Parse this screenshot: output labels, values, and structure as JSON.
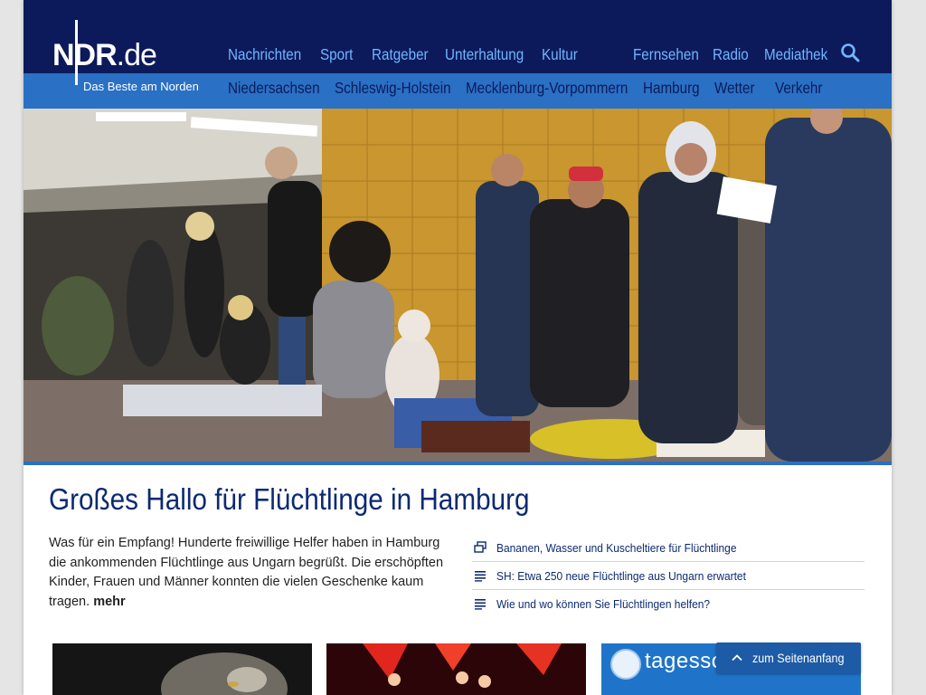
{
  "site": {
    "logo_main": "NDR",
    "logo_suffix": ".de",
    "tagline": "Das Beste am Norden"
  },
  "nav_main": [
    "Nachrichten",
    "Sport",
    "Ratgeber",
    "Unterhaltung",
    "Kultur",
    "Fernsehen",
    "Radio",
    "Mediathek"
  ],
  "nav_sub": [
    "Niedersachsen",
    "Schleswig-Holstein",
    "Mecklenburg-Vorpommern",
    "Hamburg",
    "Wetter",
    "Verkehr"
  ],
  "icons": {
    "search": "search-icon",
    "gallery": "gallery-icon",
    "article": "article-icon",
    "up": "chevron-up-icon"
  },
  "colors": {
    "header": "#0c1a5b",
    "nav_band": "#2a70c4",
    "link": "#6fb6ff",
    "headline": "#0c2a72"
  },
  "hero": {
    "headline": "Großes Hallo für Flüchtlinge in Hamburg",
    "teaser": "Was für ein Empfang! Hunderte freiwillige Helfer haben in Hamburg die ankommenden Flüchtlinge aus Ungarn begrüßt. Die erschöpften Kinder, Frauen und Männer konnten die vielen Geschenke kaum tragen.",
    "more": "mehr"
  },
  "related": [
    {
      "icon": "gallery-icon",
      "label": "Bananen, Wasser und Kuscheltiere für Flüchtlinge"
    },
    {
      "icon": "article-icon",
      "label": "SH: Etwa 250 neue Flüchtlinge aus Ungarn erwartet"
    },
    {
      "icon": "article-icon",
      "label": "Wie und wo können Sie Flüchtlingen helfen?"
    }
  ],
  "tiles": {
    "tagesschau": "tagesschau.de"
  },
  "to_top": "zum Seitenanfang"
}
